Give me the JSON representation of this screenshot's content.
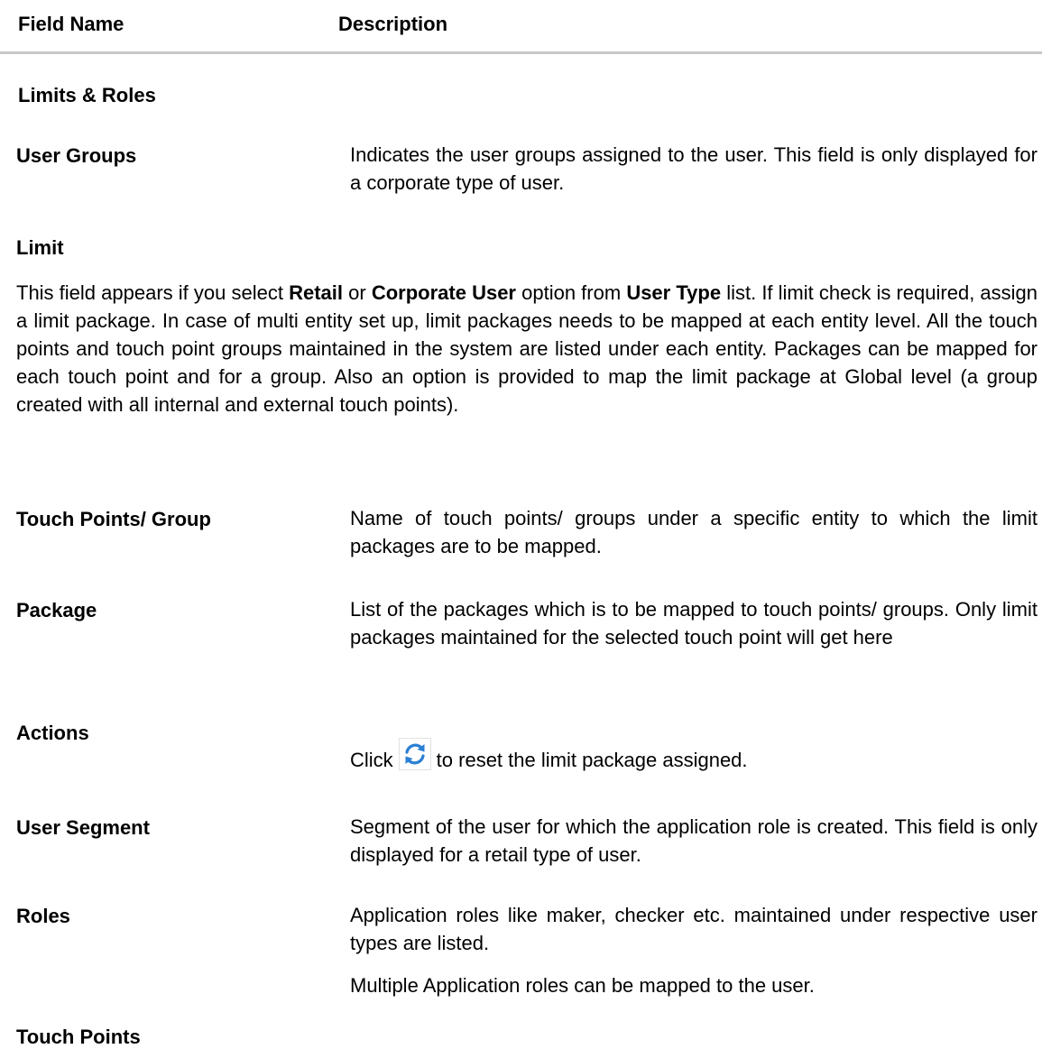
{
  "header": {
    "field_name": "Field Name",
    "description": "Description"
  },
  "sections": {
    "limits_roles": "Limits & Roles",
    "limit": "Limit",
    "touch_points": "Touch Points"
  },
  "user_groups": {
    "name": "User Groups",
    "description": "Indicates the user groups assigned to the user. This field is only displayed for a corporate type of user."
  },
  "limit_paragraph": {
    "p1": "This field appears if you select ",
    "retail": "Retail",
    "p2": " or ",
    "corporate_user": "Corporate User",
    "p3": " option from ",
    "user_type": "User Type",
    "p4": " list. If limit check is required, assign a limit package. In case of multi entity set up, limit packages needs to be mapped at each entity level. All the touch points and touch point groups maintained in the system are listed under each entity. Packages can be mapped for each touch point and for a group. Also an option is provided to map the limit package at Global level (a group created with all internal and external touch points)."
  },
  "touch_points_group": {
    "name": "Touch Points/ Group",
    "description": "Name of touch points/ groups under a specific entity to which the limit packages are to be mapped."
  },
  "package": {
    "name": "Package",
    "description": "List of the packages which is to be mapped to touch points/ groups. Only limit packages maintained for the selected touch point will get here"
  },
  "actions": {
    "name": "Actions",
    "click": "Click",
    "icon": "refresh-icon",
    "rest": "to reset the limit package assigned."
  },
  "user_segment": {
    "name": "User Segment",
    "description": "Segment of the user for which the application role is created. This field is only displayed for a retail type of user."
  },
  "roles": {
    "name": "Roles",
    "description": "Application roles like maker, checker etc. maintained under respective user types are listed.",
    "note": "Multiple Application roles can be mapped to the user."
  },
  "colors": {
    "icon_blue": "#2a7fd4",
    "divider": "#c8c8c8"
  }
}
